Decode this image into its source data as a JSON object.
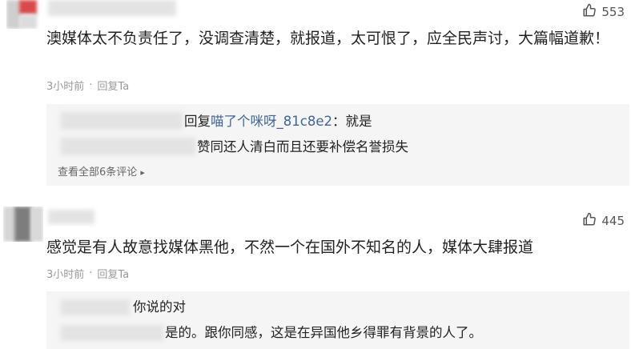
{
  "comments": [
    {
      "likes": "553",
      "text": "澳媒体太不负责任了，没调查清楚，就报道，太可恨了，应全民声讨，大篇幅道歉！",
      "time": "3小时前",
      "reply_label": "回复Ta",
      "replies": [
        {
          "prefix": "回复",
          "target": "喵了个咪呀_81c8e2",
          "text": "：就是"
        },
        {
          "text": "赞同还人清白而且还要补偿名誉损失"
        }
      ],
      "view_all": "查看全部6条评论"
    },
    {
      "likes": "445",
      "text": "感觉是有人故意找媒体黑他，不然一个在国外不知名的人，媒体大肆报道",
      "time": "3小时前",
      "reply_label": "回复Ta",
      "replies": [
        {
          "text": "你说的对"
        },
        {
          "text": "是的。跟你同感，这是在异国他乡得罪有背景的人了。"
        }
      ]
    }
  ],
  "meta_separator": "·",
  "colors": {
    "username": "#406599",
    "meta": "#999999",
    "reply_bg": "#f5f5f5"
  },
  "icons": {
    "like": "thumbs-up-icon",
    "chevron": "chevron-right-icon"
  }
}
